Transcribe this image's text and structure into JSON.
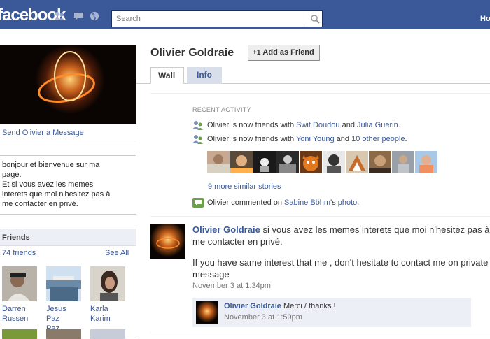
{
  "topbar": {
    "logo": "facebook",
    "search_placeholder": "Search",
    "home_label": "Ho",
    "colors": {
      "bar": "#3b5998",
      "link": "#3b5998"
    },
    "icons": [
      "friend-requests-icon",
      "messages-icon",
      "notifications-globe-icon",
      "search-icon"
    ]
  },
  "sidebar": {
    "send_message": "Send Olivier a Message",
    "bio_lines": [
      "bonjour et bienvenue sur ma",
      "page.",
      "Et si vous avez les memes",
      "interets que moi n'hesitez pas à",
      "me contacter en privé."
    ],
    "friends": {
      "header": "Friends",
      "count": "74 friends",
      "see_all": "See All",
      "items": [
        {
          "first": "Darren",
          "last": "Russen"
        },
        {
          "first": "Jesus Paz",
          "last": "Paz"
        },
        {
          "first": "Karla",
          "last": "Karim"
        }
      ]
    }
  },
  "profile": {
    "name": "Olivier Goldraie",
    "add_friend": "Add as Friend",
    "add_friend_icon": "+1",
    "tabs": [
      {
        "label": "Wall",
        "active": true
      },
      {
        "label": "Info",
        "active": false
      }
    ]
  },
  "recent_activity": {
    "title": "RECENT ACTIVITY",
    "item1": {
      "prefix": "Olivier is now friends with ",
      "a": "Swit Doudou",
      "mid": " and ",
      "b": "Julia Guerin",
      "suffix": "."
    },
    "item2": {
      "prefix": "Olivier is now friends with ",
      "a": "Yoni Young",
      "mid": " and ",
      "b": "10 other people",
      "suffix": "."
    },
    "more": "9 more similar stories",
    "item3": {
      "prefix": "Olivier commented on ",
      "a": "Sabine Böhm",
      "mid": "'s ",
      "b": "photo",
      "suffix": "."
    }
  },
  "wall_post": {
    "author": "Olivier Goldraie",
    "text1": " si vous avez les memes interets que moi n'hesitez pas à me contacter en privé.",
    "text2": "If you have same interest that me , don't hesitate to contact me on private message",
    "date": "November 3 at 1:34pm",
    "comment": {
      "author": "Olivier Goldraie",
      "text": " Merci / thanks !",
      "date": "November 3 at 1:59pm"
    }
  }
}
